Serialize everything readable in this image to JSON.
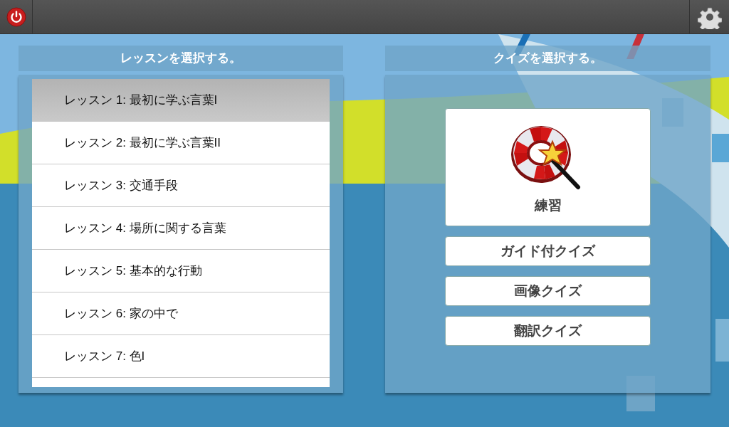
{
  "lessons_panel": {
    "title": "レッスンを選択する。",
    "lessons": [
      {
        "label": "レッスン 1: 最初に学ぶ言葉I",
        "selected": true
      },
      {
        "label": "レッスン 2: 最初に学ぶ言葉II",
        "selected": false
      },
      {
        "label": "レッスン 3: 交通手段",
        "selected": false
      },
      {
        "label": "レッスン 4: 場所に関する言葉",
        "selected": false
      },
      {
        "label": "レッスン 5: 基本的な行動",
        "selected": false
      },
      {
        "label": "レッスン 6: 家の中で",
        "selected": false
      },
      {
        "label": "レッスン 7: 色I",
        "selected": false
      }
    ]
  },
  "quiz_panel": {
    "title": "クイズを選択する。",
    "quizzes": [
      {
        "kind": "practice",
        "label": "練習"
      },
      {
        "kind": "plain",
        "label": "ガイド付クイズ"
      },
      {
        "kind": "plain",
        "label": "画像クイズ"
      },
      {
        "kind": "plain",
        "label": "翻訳クイズ"
      }
    ]
  }
}
